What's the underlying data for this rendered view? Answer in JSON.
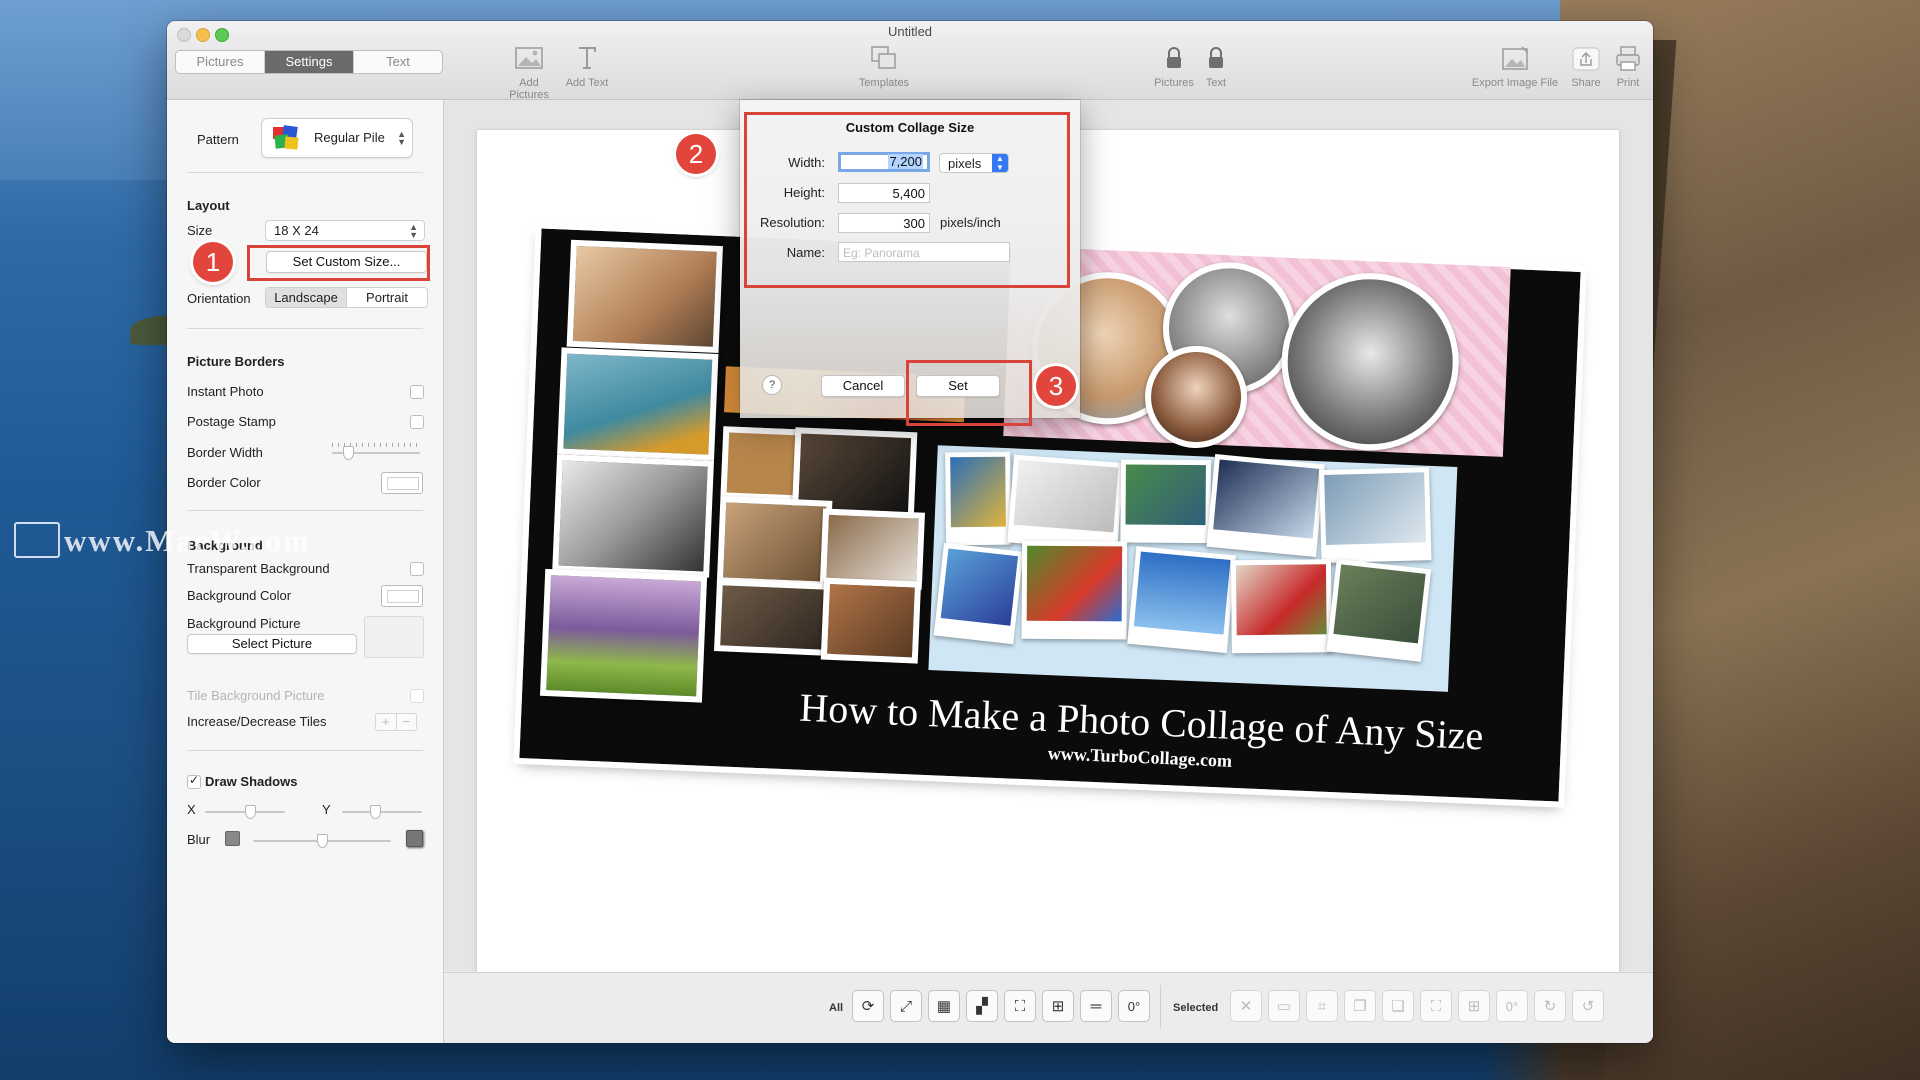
{
  "window": {
    "title": "Untitled"
  },
  "tabs": [
    "Pictures",
    "Settings",
    "Text"
  ],
  "toolbar": {
    "add_pictures": "Add Pictures",
    "add_text": "Add Text",
    "templates": "Templates",
    "lock_pictures": "Pictures",
    "lock_text": "Text",
    "export": "Export Image File",
    "share": "Share",
    "print": "Print"
  },
  "sidebar": {
    "pattern_label": "Pattern",
    "pattern_value": "Regular Pile",
    "layout_heading": "Layout",
    "size_label": "Size",
    "size_value": "18 X 24",
    "custom_size_button": "Set Custom Size...",
    "orientation_label": "Orientation",
    "orientation_options": [
      "Landscape",
      "Portrait"
    ],
    "borders_heading": "Picture Borders",
    "instant_photo": "Instant Photo",
    "postage_stamp": "Postage Stamp",
    "border_width": "Border Width",
    "border_color": "Border Color",
    "background_heading": "Background",
    "transparent_bg": "Transparent Background",
    "bg_color": "Background Color",
    "bg_picture": "Background Picture",
    "select_picture": "Select Picture",
    "tile_bg": "Tile Background Picture",
    "increase_tiles": "Increase/Decrease Tiles",
    "draw_shadows": "Draw Shadows",
    "x_label": "X",
    "y_label": "Y",
    "blur_label": "Blur"
  },
  "dialog": {
    "title": "Custom Collage Size",
    "width_label": "Width:",
    "width_value": "7,200",
    "width_unit": "pixels",
    "height_label": "Height:",
    "height_value": "5,400",
    "resolution_label": "Resolution:",
    "resolution_value": "300",
    "resolution_unit": "pixels/inch",
    "name_label": "Name:",
    "name_placeholder": "Eg: Panorama",
    "help": "?",
    "cancel": "Cancel",
    "set": "Set"
  },
  "collage": {
    "title": "How to Make a Photo Collage of Any Size",
    "url": "www.TurboCollage.com"
  },
  "bottom": {
    "all_label": "All",
    "selected_label": "Selected",
    "rotation_value": "0°",
    "rotation_value_selected": "0°"
  },
  "annotations": [
    "1",
    "2",
    "3"
  ],
  "watermark": "www.MacW.com",
  "colors": {
    "accent": "#3478f6",
    "annotation_red": "#d9443a",
    "active_tab": "#6b6b6b"
  }
}
